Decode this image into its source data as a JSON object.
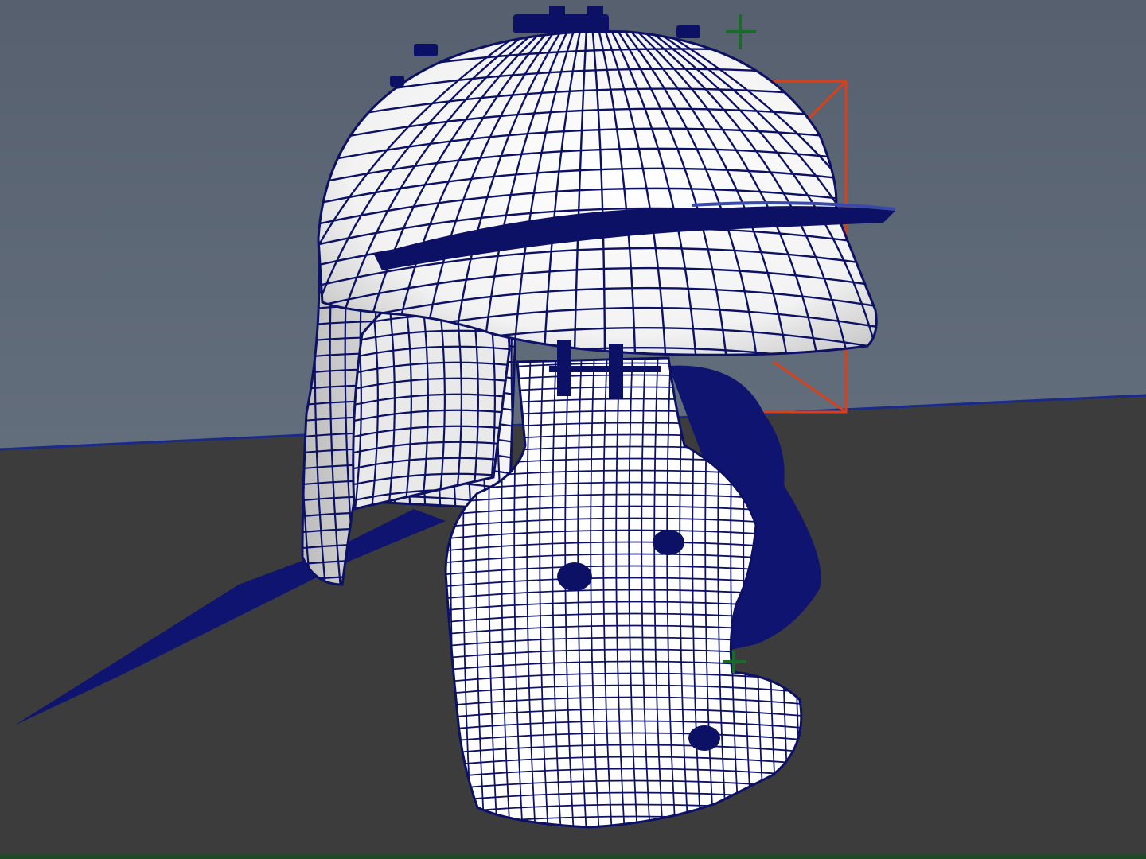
{
  "viewport": {
    "view": "perspective",
    "shading": "wireframe-on-shaded",
    "colors": {
      "sky_top": "#56606e",
      "sky_bottom": "#6f7b8a",
      "ground": "#3c3c3c",
      "horizon": "#1a2a8a",
      "mesh_fill": "#ffffff",
      "mesh_shade": "#c9c9c9",
      "wireframe": "#0d1166",
      "shadow": "#0f1470",
      "bounding_box": "#d9401a",
      "manipulator": "#1a6a2a"
    }
  },
  "objects": [
    {
      "name": "helmet-bowl",
      "type": "mesh",
      "selected": false
    },
    {
      "name": "helmet-brim",
      "type": "mesh",
      "selected": false
    },
    {
      "name": "neck-guard",
      "type": "mesh",
      "selected": false
    },
    {
      "name": "cheek-guard",
      "type": "mesh",
      "selected": false
    }
  ],
  "selection": {
    "bounding_box_visible": true,
    "manipulator_icon": "plus-cross-icon"
  }
}
